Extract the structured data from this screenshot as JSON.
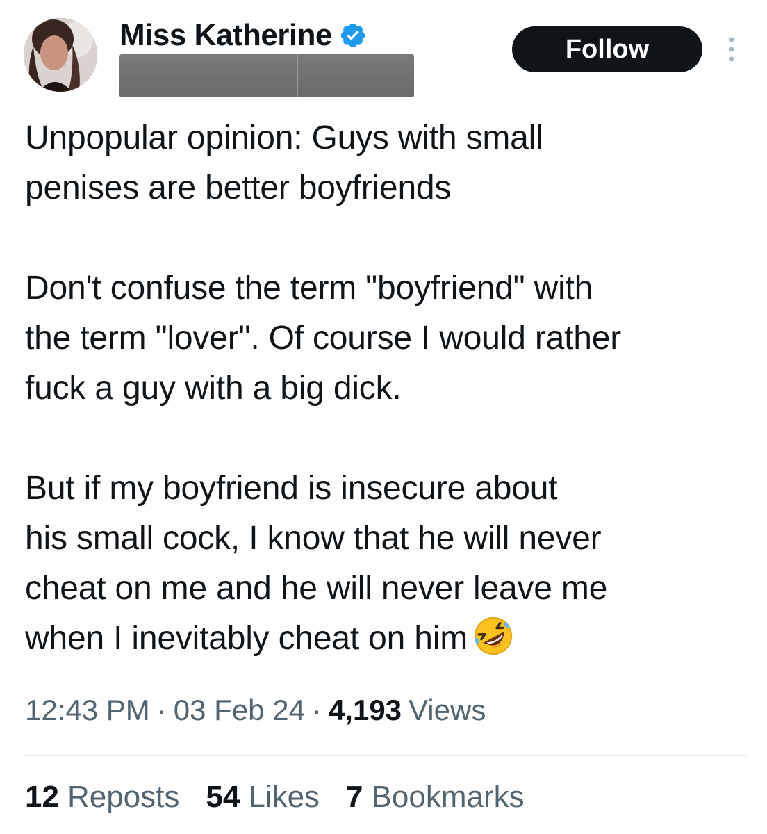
{
  "author": {
    "display_name": "Miss Katherine",
    "verified": true,
    "handle_redacted": true
  },
  "header": {
    "follow_label": "Follow"
  },
  "tweet": {
    "text": "Unpopular opinion: Guys with small\npenises are better boyfriends\n\nDon't confuse the term \"boyfriend\" with\nthe term \"lover\". Of course I would rather\nfuck a guy with a big dick.\n\nBut if my boyfriend is insecure about\nhis small cock, I know that he will never\ncheat on me and he will never leave me\nwhen I inevitably cheat on him",
    "trailing_emoji": "rolling-on-floor-laughing-emoji"
  },
  "meta": {
    "time": "12:43 PM",
    "date": "03 Feb 24",
    "views_count": "4,193",
    "views_label": "Views",
    "separator": "·"
  },
  "stats": {
    "reposts_count": "12",
    "reposts_label": "Reposts",
    "likes_count": "54",
    "likes_label": "Likes",
    "bookmarks_count": "7",
    "bookmarks_label": "Bookmarks"
  },
  "colors": {
    "text_primary": "#0f1419",
    "text_secondary": "#536471",
    "verified_blue": "#1d9bf0",
    "follow_bg": "#0f1419",
    "divider": "#e6ecf0"
  }
}
